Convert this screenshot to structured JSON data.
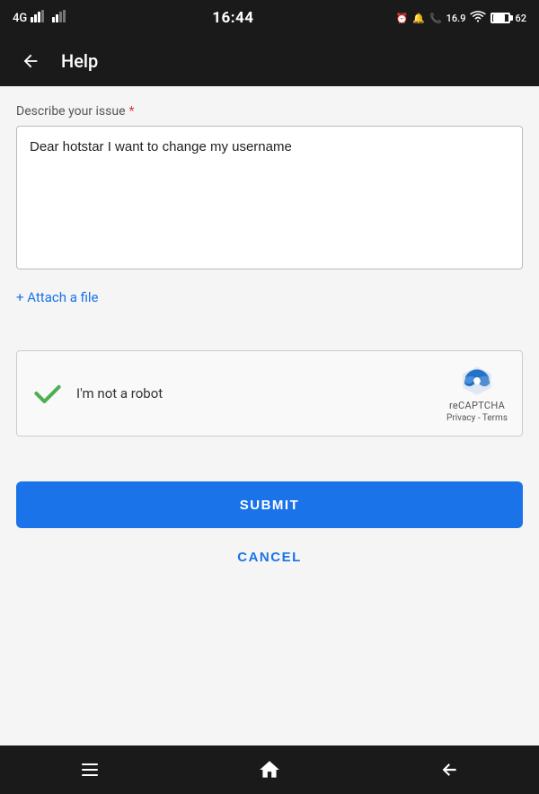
{
  "statusBar": {
    "time": "16:44",
    "leftIcons": "4G",
    "rightText": "16.9",
    "batteryLevel": 62
  },
  "navBar": {
    "title": "Help",
    "backLabel": "←"
  },
  "form": {
    "fieldLabel": "Describe your issue",
    "requiredMark": "*",
    "textareaValue": "Dear hotstar I want to change my username",
    "attachLabel": "+ Attach a file",
    "recaptchaLabel": "I'm not a robot",
    "recaptchaBrand": "reCAPTCHA",
    "recaptchaLinks": "Privacy - Terms",
    "submitLabel": "SUBMIT",
    "cancelLabel": "CANCEL"
  },
  "bottomNav": {
    "menuIcon": "≡",
    "homeIcon": "⌂",
    "backIcon": "↩"
  }
}
